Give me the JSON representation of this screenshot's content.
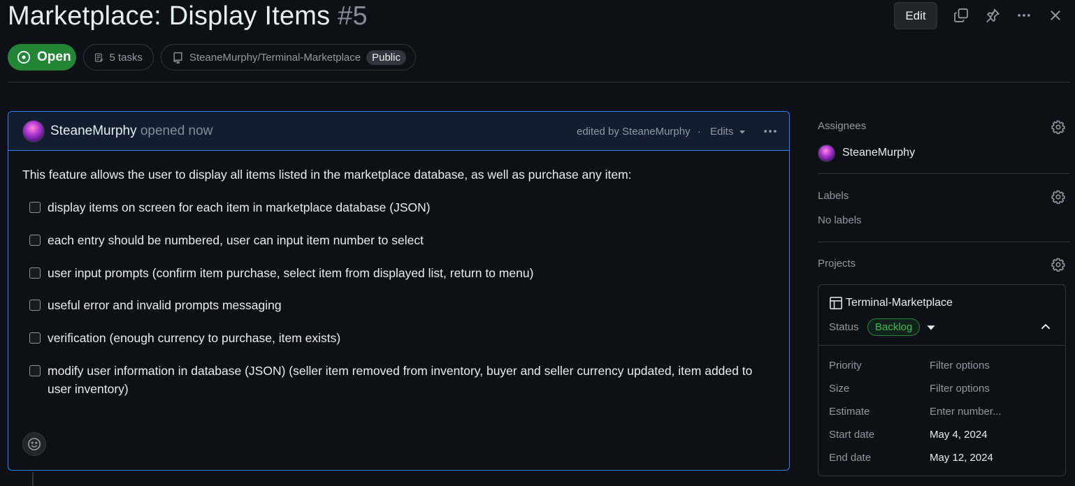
{
  "issue": {
    "title": "Marketplace: Display Items",
    "number": "#5",
    "state": "Open",
    "tasks": "5 tasks",
    "repo": "SteaneMurphy/Terminal-Marketplace",
    "visibility": "Public"
  },
  "toolbar": {
    "edit_label": "Edit"
  },
  "comment": {
    "author": "SteaneMurphy",
    "action": "opened now",
    "edited_by": "edited by SteaneMurphy",
    "separator": "·",
    "edits_label": "Edits",
    "intro": "This feature allows the user to display all items listed in the marketplace database, as well as purchase any item:",
    "tasks": [
      "display items on screen for each item in marketplace database (JSON)",
      "each entry should be numbered, user can input item number to select",
      "user input prompts (confirm item purchase, select item from displayed list, return to menu)",
      "useful error and invalid prompts messaging",
      "verification (enough currency to purchase, item exists)",
      "modify user information in database (JSON) (seller item removed from inventory, buyer and seller currency updated, item added to user inventory)"
    ]
  },
  "sidebar": {
    "assignees_label": "Assignees",
    "assignee": "SteaneMurphy",
    "labels_label": "Labels",
    "labels_empty": "No labels",
    "projects_label": "Projects",
    "project": {
      "name": "Terminal-Marketplace",
      "status_label": "Status",
      "status_value": "Backlog",
      "fields": [
        {
          "key": "Priority",
          "value": "Filter options",
          "placeholder": true
        },
        {
          "key": "Size",
          "value": "Filter options",
          "placeholder": true
        },
        {
          "key": "Estimate",
          "value": "Enter number...",
          "placeholder": true
        },
        {
          "key": "Start date",
          "value": "May 4, 2024",
          "placeholder": false
        },
        {
          "key": "End date",
          "value": "May 12, 2024",
          "placeholder": false
        }
      ]
    }
  },
  "colors": {
    "background": "#0d1117",
    "open_green": "#238636",
    "focus_blue": "#2f81f7",
    "backlog_green": "#3fb950"
  }
}
